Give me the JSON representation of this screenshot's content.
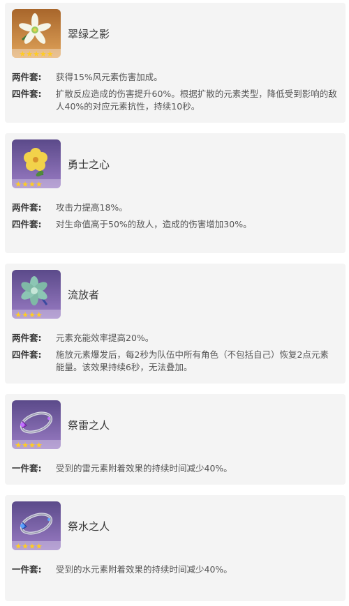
{
  "artifacts": [
    {
      "name": "翠绿之影",
      "rarity": 5,
      "frame_color": "#c8813c",
      "effects": [
        {
          "label": "两件套:",
          "text": "获得15%风元素伤害加成。"
        },
        {
          "label": "四件套:",
          "text": "扩散反应造成的伤害提升60%。根据扩散的元素类型，降低受到影响的敌人40%的对应元素抗性，持续10秒。"
        }
      ]
    },
    {
      "name": "勇士之心",
      "rarity": 4,
      "frame_color": "#8a6bb0",
      "effects": [
        {
          "label": "两件套:",
          "text": "攻击力提高18%。"
        },
        {
          "label": "四件套:",
          "text": "对生命值高于50%的敌人，造成的伤害增加30%。"
        }
      ]
    },
    {
      "name": "流放者",
      "rarity": 4,
      "frame_color": "#8a6bb0",
      "effects": [
        {
          "label": "两件套:",
          "text": "元素充能效率提高20%。"
        },
        {
          "label": "四件套:",
          "text": "施放元素爆发后，每2秒为队伍中所有角色（不包括自己）恢复2点元素能量。该效果持续6秒，无法叠加。"
        }
      ]
    },
    {
      "name": "祭雷之人",
      "rarity": 4,
      "frame_color": "#8a6bb0",
      "effects": [
        {
          "label": "一件套:",
          "text": "受到的雷元素附着效果的持续时间减少40%。"
        }
      ]
    },
    {
      "name": "祭水之人",
      "rarity": 4,
      "frame_color": "#8a6bb0",
      "effects": [
        {
          "label": "一件套:",
          "text": "受到的水元素附着效果的持续时间减少40%。"
        }
      ]
    }
  ]
}
